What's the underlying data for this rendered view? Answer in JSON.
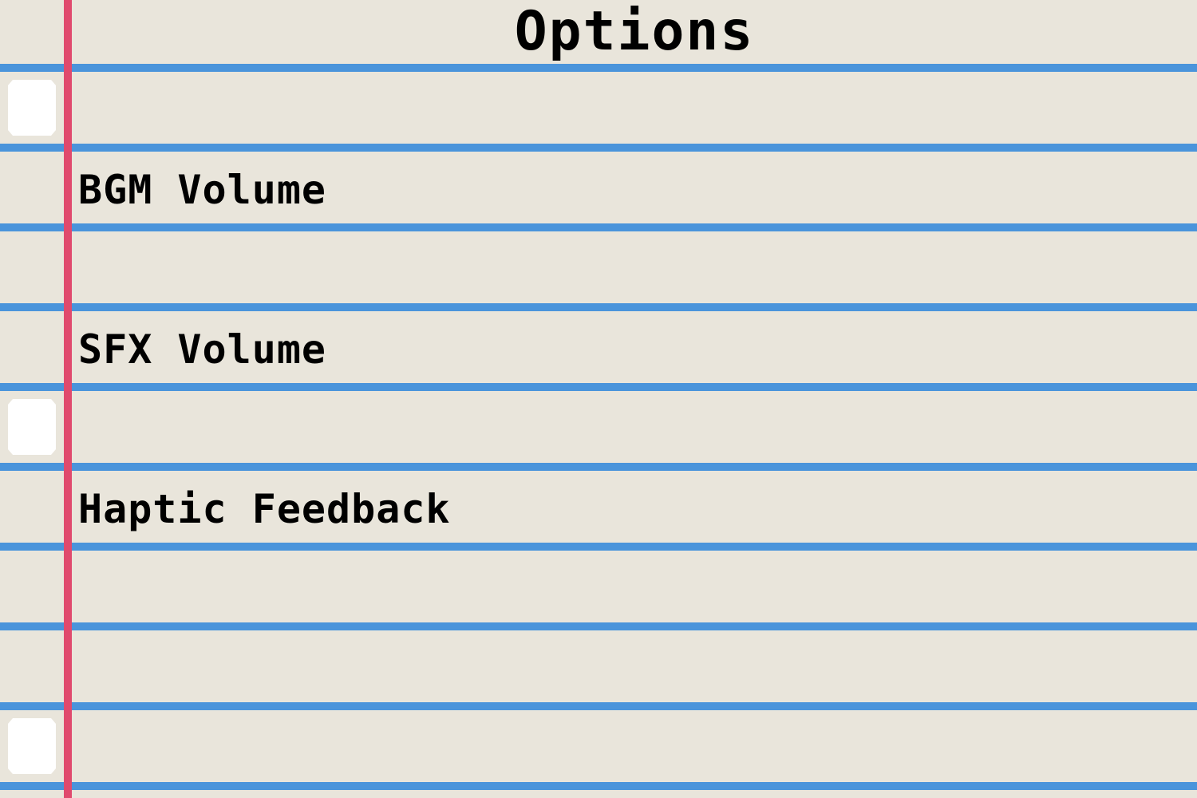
{
  "screen": {
    "title": "Options"
  },
  "options": [
    {
      "label": "BGM Volume"
    },
    {
      "label": "SFX Volume"
    },
    {
      "label": "Haptic Feedback"
    }
  ],
  "colors": {
    "paper": "#E9E5DB",
    "rule_line": "#4A94DB",
    "margin_line": "#E04A6E",
    "punch_hole": "#FFFFFF",
    "text": "#000000"
  }
}
